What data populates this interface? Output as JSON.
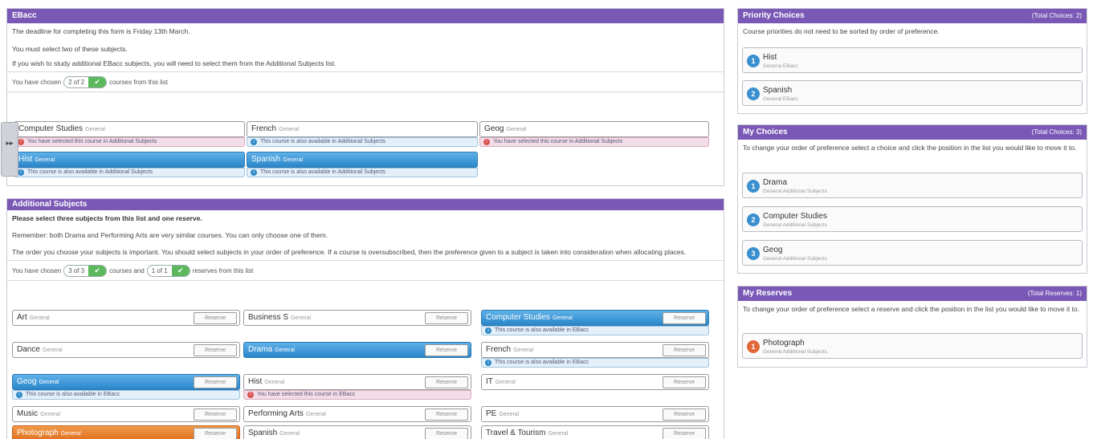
{
  "ebacc": {
    "title": "EBacc",
    "deadline": "The deadline for completing this form is Friday 13th March.",
    "instruction": "You must select two of these subjects.",
    "additional_note": "If you wish to study additional EBacc subjects, you will need to select them from the Additional Subjects list.",
    "chosen_prefix": "You have chosen",
    "chosen_value": "2 of 2",
    "chosen_suffix": "courses from this list",
    "courses": [
      {
        "name": "Computer Studies",
        "tag": "General",
        "note": "You have selected this course in Additional Subjects",
        "note_type": "pink"
      },
      {
        "name": "French",
        "tag": "General",
        "note": "This course is also available in Additional Subjects",
        "note_type": "info"
      },
      {
        "name": "Geog",
        "tag": "General",
        "note": "You have selected this course in Additional Subjects",
        "note_type": "pink"
      },
      {
        "name": "Hist",
        "tag": "General",
        "note": "This course is also available in Additional Subjects",
        "note_type": "info"
      },
      {
        "name": "Spanish",
        "tag": "General",
        "note": "This course is also available in Additional Subjects",
        "note_type": "info"
      }
    ]
  },
  "additional": {
    "title": "Additional Subjects",
    "line1": "Please select three subjects from this list and one reserve.",
    "line2": "Remember: both Drama and Performing Arts are very similar courses.  You can only choose one of them.",
    "line3": "The order you choose your subjects is important.  You should select subjects in your order of preference.  If a course is oversubscribed, then the preference given to a subject is taken into consideration when allocating places.",
    "chosen_prefix": "You have chosen",
    "chosen_value": "3 of 3",
    "chosen_mid": "courses and",
    "reserve_value": "1 of 1",
    "chosen_suffix": "reserves from this list",
    "reserve_label": "Reserve",
    "courses": [
      {
        "name": "Art",
        "tag": "General"
      },
      {
        "name": "Business S",
        "tag": "General"
      },
      {
        "name": "Computer Studies",
        "tag": "General",
        "note": "This course is also available in EBacc"
      },
      {
        "name": "Dance",
        "tag": "General"
      },
      {
        "name": "Drama",
        "tag": "General"
      },
      {
        "name": "French",
        "tag": "General",
        "note": "This course is also available in EBacc"
      },
      {
        "name": "Geog",
        "tag": "General",
        "note": "This course is also available in EBacc"
      },
      {
        "name": "Hist",
        "tag": "General",
        "note": "You have selected this course in EBacc"
      },
      {
        "name": "IT",
        "tag": "General"
      },
      {
        "name": "Music",
        "tag": "General"
      },
      {
        "name": "Performing Arts",
        "tag": "General"
      },
      {
        "name": "PE",
        "tag": "General"
      },
      {
        "name": "Photograph",
        "tag": "General"
      },
      {
        "name": "Spanish",
        "tag": "General"
      },
      {
        "name": "Travel & Tourism",
        "tag": "General"
      }
    ]
  },
  "priority": {
    "title": "Priority Choices",
    "count": "(Total Choices: 2)",
    "desc": "Course priorities do not need to be sorted by order of preference.",
    "items": [
      {
        "num": "1",
        "name": "Hist",
        "sub": "General EBacc"
      },
      {
        "num": "2",
        "name": "Spanish",
        "sub": "General EBacc"
      }
    ]
  },
  "my_choices": {
    "title": "My Choices",
    "count": "(Total Choices: 3)",
    "desc": "To change your order of preference select a choice and click the position in the list you would like to move it to.",
    "items": [
      {
        "num": "1",
        "name": "Drama",
        "sub": "General Additional Subjects"
      },
      {
        "num": "2",
        "name": "Computer Studies",
        "sub": "General Additional Subjects"
      },
      {
        "num": "3",
        "name": "Geog",
        "sub": "General Additional Subjects"
      }
    ]
  },
  "my_reserves": {
    "title": "My Reserves",
    "count": "(Total Reserves: 1)",
    "desc": "To change your order of preference select a reserve and click the position in the list you would like to move it to.",
    "items": [
      {
        "num": "1",
        "name": "Photograph",
        "sub": "General Additional Subjects"
      }
    ]
  },
  "side_tab": {
    "label": "▸▸"
  },
  "check_icon": "✔"
}
